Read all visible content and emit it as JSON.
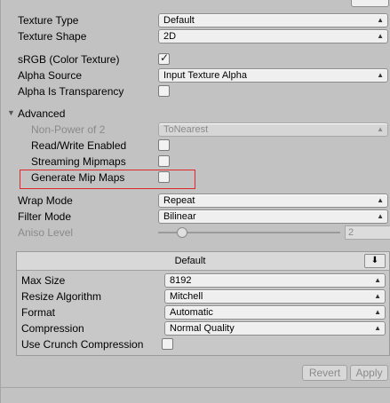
{
  "texture_type": {
    "label": "Texture Type",
    "value": "Default"
  },
  "texture_shape": {
    "label": "Texture Shape",
    "value": "2D"
  },
  "srgb": {
    "label": "sRGB (Color Texture)",
    "checked": true
  },
  "alpha_source": {
    "label": "Alpha Source",
    "value": "Input Texture Alpha"
  },
  "alpha_transparency": {
    "label": "Alpha Is Transparency",
    "checked": false
  },
  "advanced": {
    "label": "Advanced",
    "npot": {
      "label": "Non-Power of 2",
      "value": "ToNearest"
    },
    "read_write": {
      "label": "Read/Write Enabled",
      "checked": false
    },
    "streaming": {
      "label": "Streaming Mipmaps",
      "checked": false
    },
    "mipmaps": {
      "label": "Generate Mip Maps",
      "checked": false
    }
  },
  "wrap_mode": {
    "label": "Wrap Mode",
    "value": "Repeat"
  },
  "filter_mode": {
    "label": "Filter Mode",
    "value": "Bilinear"
  },
  "aniso": {
    "label": "Aniso Level",
    "value": "2"
  },
  "platform": {
    "tab": "Default",
    "max_size": {
      "label": "Max Size",
      "value": "8192"
    },
    "resize": {
      "label": "Resize Algorithm",
      "value": "Mitchell"
    },
    "format": {
      "label": "Format",
      "value": "Automatic"
    },
    "compression": {
      "label": "Compression",
      "value": "Normal Quality"
    },
    "crunch": {
      "label": "Use Crunch Compression",
      "checked": false
    }
  },
  "buttons": {
    "revert": "Revert",
    "apply": "Apply"
  },
  "colors": {
    "highlight": "#e0282a",
    "background": "#c2c2c2"
  }
}
